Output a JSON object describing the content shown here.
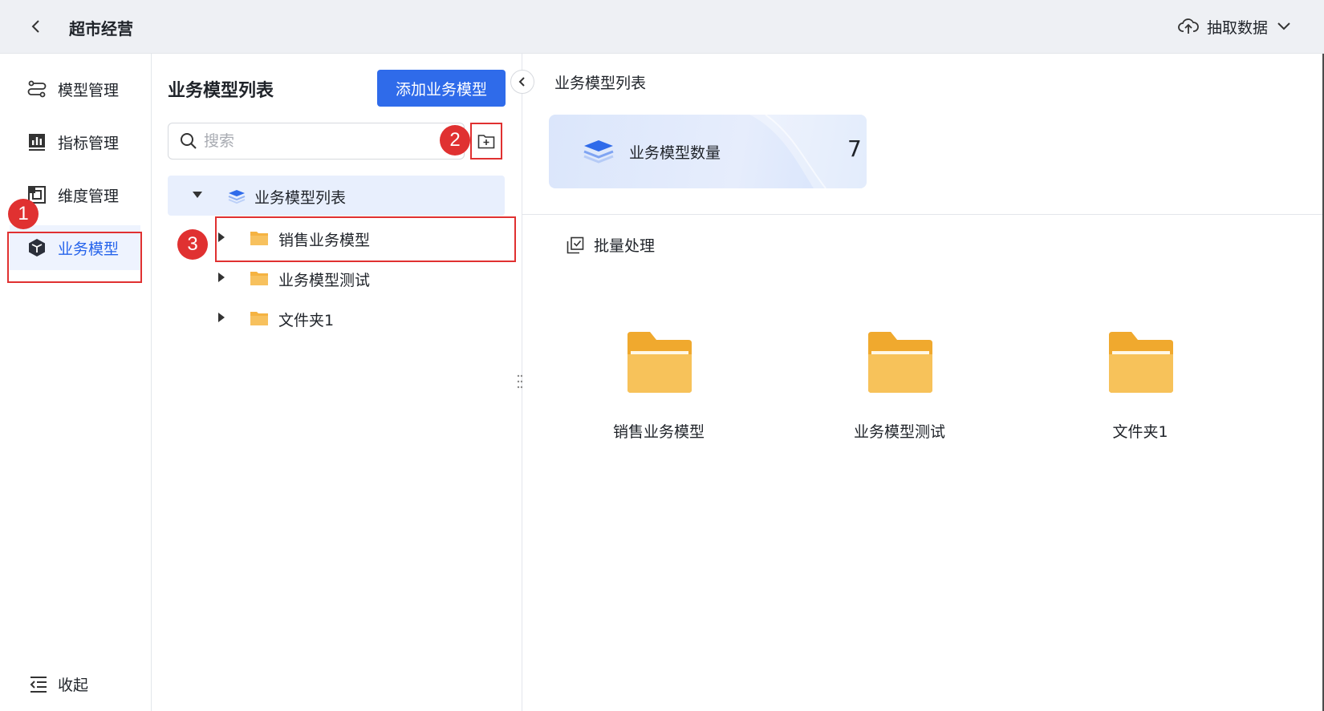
{
  "header": {
    "title": "超市经营",
    "extract_label": "抽取数据"
  },
  "nav": {
    "items": [
      {
        "label": "模型管理",
        "icon": "model-manage-icon"
      },
      {
        "label": "指标管理",
        "icon": "metric-chart-icon"
      },
      {
        "label": "维度管理",
        "icon": "dimension-icon"
      },
      {
        "label": "业务模型",
        "icon": "cube-icon",
        "active": true
      }
    ],
    "collapse_label": "收起"
  },
  "middle": {
    "title": "业务模型列表",
    "add_button": "添加业务模型",
    "search_placeholder": "搜索",
    "tree": {
      "root": "业务模型列表",
      "children": [
        "销售业务模型",
        "业务模型测试",
        "文件夹1"
      ]
    }
  },
  "right": {
    "breadcrumb": "业务模型列表",
    "stat": {
      "label": "业务模型数量",
      "value": "7"
    },
    "batch_label": "批量处理",
    "folders": [
      "销售业务模型",
      "业务模型测试",
      "文件夹1"
    ]
  },
  "annotations": {
    "badge1": "1",
    "badge2": "2",
    "badge3": "3"
  },
  "colors": {
    "accent": "#2f6bea",
    "highlight": "#e03131",
    "folder": "#f5b342"
  }
}
